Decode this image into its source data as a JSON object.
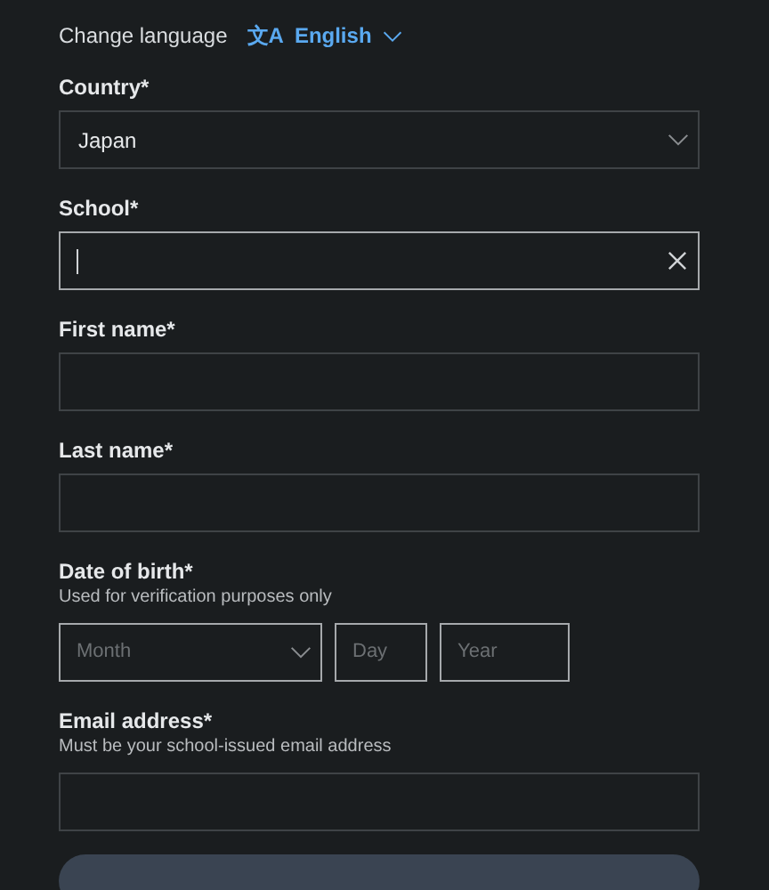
{
  "language": {
    "label": "Change language",
    "icon_text": "文A",
    "value": "English"
  },
  "fields": [
    {
      "kind": "select",
      "label": "Country*",
      "value": "Japan"
    },
    {
      "kind": "search",
      "label": "School*",
      "focused": true
    },
    {
      "kind": "text",
      "label": "First name*"
    },
    {
      "kind": "text",
      "label": "Last name*"
    },
    {
      "kind": "date",
      "label": "Date of birth*",
      "hint": "Used for verification purposes only",
      "parts": [
        {
          "kind": "select",
          "placeholder": "Month"
        },
        {
          "kind": "text",
          "placeholder": "Day"
        },
        {
          "kind": "text",
          "placeholder": "Year"
        }
      ]
    },
    {
      "kind": "text",
      "label": "Email address*",
      "hint": "Must be your school-issued email address"
    }
  ],
  "submit": {
    "disabled": true
  }
}
